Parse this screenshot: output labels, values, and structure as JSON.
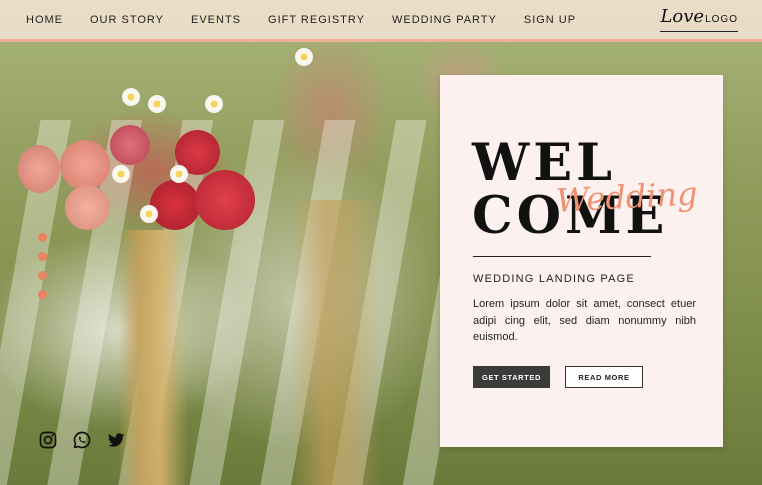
{
  "nav": {
    "items": [
      "HOME",
      "OUR STORY",
      "EVENTS",
      "GIFT REGISTRY",
      "WEDDING PARTY",
      "SIGN UP"
    ]
  },
  "logo": {
    "script": "Love",
    "word": "LOGO"
  },
  "hero": {
    "title_line1": "WEL",
    "title_line2": "COME",
    "script_overlay": "Wedding",
    "subtitle": "WEDDING LANDING PAGE",
    "body": "Lorem ipsum dolor sit amet, consect etuer adipi cing elit, sed diam nonummy nibh euismod.",
    "primary_button": "GET STARTED",
    "secondary_button": "READ MORE"
  },
  "slider": {
    "dot_count": 4
  },
  "social": {
    "icons": [
      "instagram-icon",
      "whatsapp-icon",
      "twitter-icon"
    ]
  },
  "colors": {
    "accent": "#ef9272",
    "dot": "#e9845e",
    "card_bg": "#fdf1ef",
    "button_dark": "#3b3b3b",
    "nav_bg": "#fce8de"
  }
}
